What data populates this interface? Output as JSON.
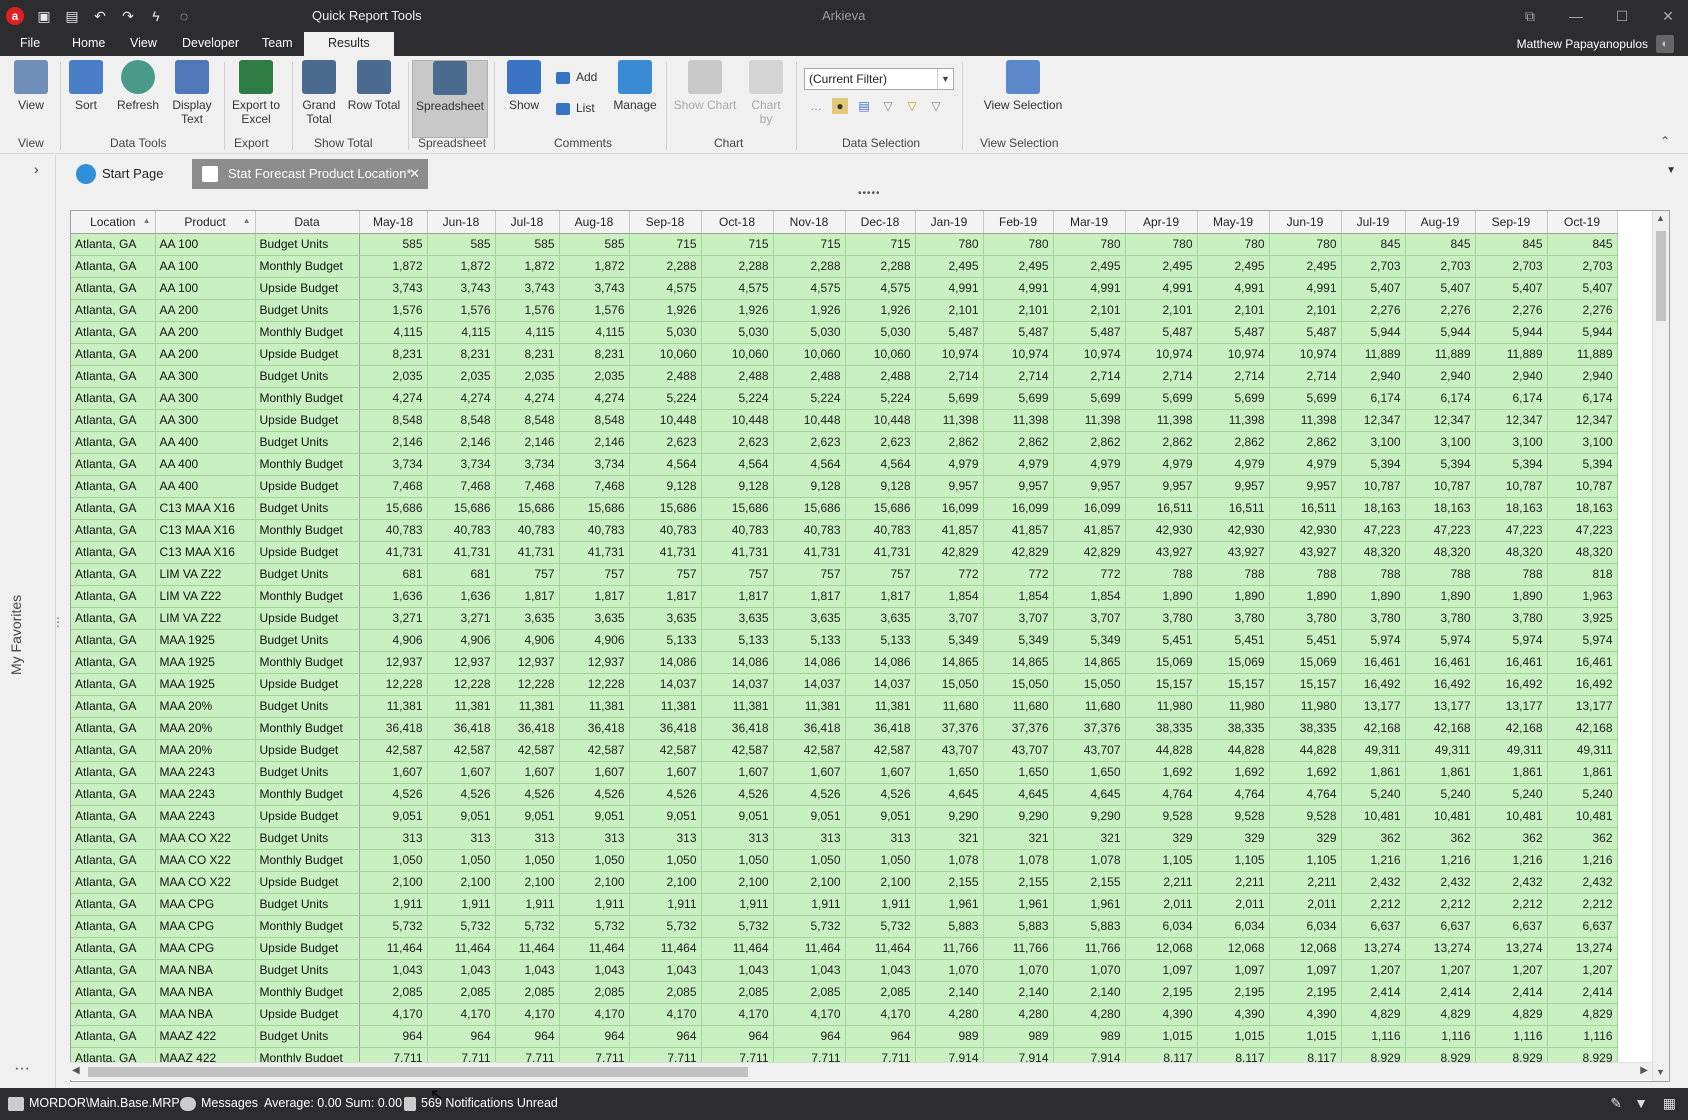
{
  "titlebar": {
    "logo": "a",
    "tool_title": "Quick Report Tools",
    "app_title": "Arkieva"
  },
  "menu": {
    "tabs": [
      "File",
      "Home",
      "View",
      "Developer",
      "Team",
      "Results"
    ],
    "active": "Results",
    "user": "Matthew Papayanopulos"
  },
  "ribbon": {
    "view": "View",
    "sort": "Sort",
    "refresh": "Refresh",
    "display_text": "Display Text",
    "export_excel": "Export to Excel",
    "grand_total": "Grand Total",
    "row_total": "Row Total",
    "spreadsheet": "Spreadsheet",
    "show": "Show",
    "add": "Add",
    "list": "List",
    "manage": "Manage",
    "show_chart": "Show Chart",
    "chart_by": "Chart by",
    "filter_value": "(Current Filter)",
    "view_selection": "View Selection",
    "groups": {
      "view": "View",
      "data_tools": "Data Tools",
      "export": "Export",
      "show_total": "Show Total",
      "spreadsheet": "Spreadsheet",
      "comments": "Comments",
      "chart": "Chart",
      "data_selection": "Data Selection",
      "view_selection": "View Selection"
    }
  },
  "sidebar": {
    "favorites": "My Favorites"
  },
  "doctabs": {
    "start": "Start Page",
    "active": "Stat Forecast Product Location*"
  },
  "grid": {
    "headers": [
      "Location",
      "Product",
      "Data",
      "May-18",
      "Jun-18",
      "Jul-18",
      "Aug-18",
      "Sep-18",
      "Oct-18",
      "Nov-18",
      "Dec-18",
      "Jan-19",
      "Feb-19",
      "Mar-19",
      "Apr-19",
      "May-19",
      "Jun-19",
      "Jul-19",
      "Aug-19",
      "Sep-19",
      "Oct-19"
    ],
    "rows": [
      [
        "Atlanta, GA",
        "AA 100",
        "Budget Units",
        "585",
        "585",
        "585",
        "585",
        "715",
        "715",
        "715",
        "715",
        "780",
        "780",
        "780",
        "780",
        "780",
        "780",
        "845",
        "845",
        "845",
        "845"
      ],
      [
        "Atlanta, GA",
        "AA 100",
        "Monthly Budget",
        "1,872",
        "1,872",
        "1,872",
        "1,872",
        "2,288",
        "2,288",
        "2,288",
        "2,288",
        "2,495",
        "2,495",
        "2,495",
        "2,495",
        "2,495",
        "2,495",
        "2,703",
        "2,703",
        "2,703",
        "2,703"
      ],
      [
        "Atlanta, GA",
        "AA 100",
        "Upside Budget",
        "3,743",
        "3,743",
        "3,743",
        "3,743",
        "4,575",
        "4,575",
        "4,575",
        "4,575",
        "4,991",
        "4,991",
        "4,991",
        "4,991",
        "4,991",
        "4,991",
        "5,407",
        "5,407",
        "5,407",
        "5,407"
      ],
      [
        "Atlanta, GA",
        "AA 200",
        "Budget Units",
        "1,576",
        "1,576",
        "1,576",
        "1,576",
        "1,926",
        "1,926",
        "1,926",
        "1,926",
        "2,101",
        "2,101",
        "2,101",
        "2,101",
        "2,101",
        "2,101",
        "2,276",
        "2,276",
        "2,276",
        "2,276"
      ],
      [
        "Atlanta, GA",
        "AA 200",
        "Monthly Budget",
        "4,115",
        "4,115",
        "4,115",
        "4,115",
        "5,030",
        "5,030",
        "5,030",
        "5,030",
        "5,487",
        "5,487",
        "5,487",
        "5,487",
        "5,487",
        "5,487",
        "5,944",
        "5,944",
        "5,944",
        "5,944"
      ],
      [
        "Atlanta, GA",
        "AA 200",
        "Upside Budget",
        "8,231",
        "8,231",
        "8,231",
        "8,231",
        "10,060",
        "10,060",
        "10,060",
        "10,060",
        "10,974",
        "10,974",
        "10,974",
        "10,974",
        "10,974",
        "10,974",
        "11,889",
        "11,889",
        "11,889",
        "11,889"
      ],
      [
        "Atlanta, GA",
        "AA 300",
        "Budget Units",
        "2,035",
        "2,035",
        "2,035",
        "2,035",
        "2,488",
        "2,488",
        "2,488",
        "2,488",
        "2,714",
        "2,714",
        "2,714",
        "2,714",
        "2,714",
        "2,714",
        "2,940",
        "2,940",
        "2,940",
        "2,940"
      ],
      [
        "Atlanta, GA",
        "AA 300",
        "Monthly Budget",
        "4,274",
        "4,274",
        "4,274",
        "4,274",
        "5,224",
        "5,224",
        "5,224",
        "5,224",
        "5,699",
        "5,699",
        "5,699",
        "5,699",
        "5,699",
        "5,699",
        "6,174",
        "6,174",
        "6,174",
        "6,174"
      ],
      [
        "Atlanta, GA",
        "AA 300",
        "Upside Budget",
        "8,548",
        "8,548",
        "8,548",
        "8,548",
        "10,448",
        "10,448",
        "10,448",
        "10,448",
        "11,398",
        "11,398",
        "11,398",
        "11,398",
        "11,398",
        "11,398",
        "12,347",
        "12,347",
        "12,347",
        "12,347"
      ],
      [
        "Atlanta, GA",
        "AA 400",
        "Budget Units",
        "2,146",
        "2,146",
        "2,146",
        "2,146",
        "2,623",
        "2,623",
        "2,623",
        "2,623",
        "2,862",
        "2,862",
        "2,862",
        "2,862",
        "2,862",
        "2,862",
        "3,100",
        "3,100",
        "3,100",
        "3,100"
      ],
      [
        "Atlanta, GA",
        "AA 400",
        "Monthly Budget",
        "3,734",
        "3,734",
        "3,734",
        "3,734",
        "4,564",
        "4,564",
        "4,564",
        "4,564",
        "4,979",
        "4,979",
        "4,979",
        "4,979",
        "4,979",
        "4,979",
        "5,394",
        "5,394",
        "5,394",
        "5,394"
      ],
      [
        "Atlanta, GA",
        "AA 400",
        "Upside Budget",
        "7,468",
        "7,468",
        "7,468",
        "7,468",
        "9,128",
        "9,128",
        "9,128",
        "9,128",
        "9,957",
        "9,957",
        "9,957",
        "9,957",
        "9,957",
        "9,957",
        "10,787",
        "10,787",
        "10,787",
        "10,787"
      ],
      [
        "Atlanta, GA",
        "C13 MAA X16",
        "Budget Units",
        "15,686",
        "15,686",
        "15,686",
        "15,686",
        "15,686",
        "15,686",
        "15,686",
        "15,686",
        "16,099",
        "16,099",
        "16,099",
        "16,511",
        "16,511",
        "16,511",
        "18,163",
        "18,163",
        "18,163",
        "18,163"
      ],
      [
        "Atlanta, GA",
        "C13 MAA X16",
        "Monthly Budget",
        "40,783",
        "40,783",
        "40,783",
        "40,783",
        "40,783",
        "40,783",
        "40,783",
        "40,783",
        "41,857",
        "41,857",
        "41,857",
        "42,930",
        "42,930",
        "42,930",
        "47,223",
        "47,223",
        "47,223",
        "47,223"
      ],
      [
        "Atlanta, GA",
        "C13 MAA X16",
        "Upside Budget",
        "41,731",
        "41,731",
        "41,731",
        "41,731",
        "41,731",
        "41,731",
        "41,731",
        "41,731",
        "42,829",
        "42,829",
        "42,829",
        "43,927",
        "43,927",
        "43,927",
        "48,320",
        "48,320",
        "48,320",
        "48,320"
      ],
      [
        "Atlanta, GA",
        "LIM VA Z22",
        "Budget Units",
        "681",
        "681",
        "757",
        "757",
        "757",
        "757",
        "757",
        "757",
        "772",
        "772",
        "772",
        "788",
        "788",
        "788",
        "788",
        "788",
        "788",
        "818"
      ],
      [
        "Atlanta, GA",
        "LIM VA Z22",
        "Monthly Budget",
        "1,636",
        "1,636",
        "1,817",
        "1,817",
        "1,817",
        "1,817",
        "1,817",
        "1,817",
        "1,854",
        "1,854",
        "1,854",
        "1,890",
        "1,890",
        "1,890",
        "1,890",
        "1,890",
        "1,890",
        "1,963"
      ],
      [
        "Atlanta, GA",
        "LIM VA Z22",
        "Upside Budget",
        "3,271",
        "3,271",
        "3,635",
        "3,635",
        "3,635",
        "3,635",
        "3,635",
        "3,635",
        "3,707",
        "3,707",
        "3,707",
        "3,780",
        "3,780",
        "3,780",
        "3,780",
        "3,780",
        "3,780",
        "3,925"
      ],
      [
        "Atlanta, GA",
        "MAA 1925",
        "Budget Units",
        "4,906",
        "4,906",
        "4,906",
        "4,906",
        "5,133",
        "5,133",
        "5,133",
        "5,133",
        "5,349",
        "5,349",
        "5,349",
        "5,451",
        "5,451",
        "5,451",
        "5,974",
        "5,974",
        "5,974",
        "5,974"
      ],
      [
        "Atlanta, GA",
        "MAA 1925",
        "Monthly Budget",
        "12,937",
        "12,937",
        "12,937",
        "12,937",
        "14,086",
        "14,086",
        "14,086",
        "14,086",
        "14,865",
        "14,865",
        "14,865",
        "15,069",
        "15,069",
        "15,069",
        "16,461",
        "16,461",
        "16,461",
        "16,461"
      ],
      [
        "Atlanta, GA",
        "MAA 1925",
        "Upside Budget",
        "12,228",
        "12,228",
        "12,228",
        "12,228",
        "14,037",
        "14,037",
        "14,037",
        "14,037",
        "15,050",
        "15,050",
        "15,050",
        "15,157",
        "15,157",
        "15,157",
        "16,492",
        "16,492",
        "16,492",
        "16,492"
      ],
      [
        "Atlanta, GA",
        "MAA 20%",
        "Budget Units",
        "11,381",
        "11,381",
        "11,381",
        "11,381",
        "11,381",
        "11,381",
        "11,381",
        "11,381",
        "11,680",
        "11,680",
        "11,680",
        "11,980",
        "11,980",
        "11,980",
        "13,177",
        "13,177",
        "13,177",
        "13,177"
      ],
      [
        "Atlanta, GA",
        "MAA 20%",
        "Monthly Budget",
        "36,418",
        "36,418",
        "36,418",
        "36,418",
        "36,418",
        "36,418",
        "36,418",
        "36,418",
        "37,376",
        "37,376",
        "37,376",
        "38,335",
        "38,335",
        "38,335",
        "42,168",
        "42,168",
        "42,168",
        "42,168"
      ],
      [
        "Atlanta, GA",
        "MAA 20%",
        "Upside Budget",
        "42,587",
        "42,587",
        "42,587",
        "42,587",
        "42,587",
        "42,587",
        "42,587",
        "42,587",
        "43,707",
        "43,707",
        "43,707",
        "44,828",
        "44,828",
        "44,828",
        "49,311",
        "49,311",
        "49,311",
        "49,311"
      ],
      [
        "Atlanta, GA",
        "MAA 2243",
        "Budget Units",
        "1,607",
        "1,607",
        "1,607",
        "1,607",
        "1,607",
        "1,607",
        "1,607",
        "1,607",
        "1,650",
        "1,650",
        "1,650",
        "1,692",
        "1,692",
        "1,692",
        "1,861",
        "1,861",
        "1,861",
        "1,861"
      ],
      [
        "Atlanta, GA",
        "MAA 2243",
        "Monthly Budget",
        "4,526",
        "4,526",
        "4,526",
        "4,526",
        "4,526",
        "4,526",
        "4,526",
        "4,526",
        "4,645",
        "4,645",
        "4,645",
        "4,764",
        "4,764",
        "4,764",
        "5,240",
        "5,240",
        "5,240",
        "5,240"
      ],
      [
        "Atlanta, GA",
        "MAA 2243",
        "Upside Budget",
        "9,051",
        "9,051",
        "9,051",
        "9,051",
        "9,051",
        "9,051",
        "9,051",
        "9,051",
        "9,290",
        "9,290",
        "9,290",
        "9,528",
        "9,528",
        "9,528",
        "10,481",
        "10,481",
        "10,481",
        "10,481"
      ],
      [
        "Atlanta, GA",
        "MAA CO X22",
        "Budget Units",
        "313",
        "313",
        "313",
        "313",
        "313",
        "313",
        "313",
        "313",
        "321",
        "321",
        "321",
        "329",
        "329",
        "329",
        "362",
        "362",
        "362",
        "362"
      ],
      [
        "Atlanta, GA",
        "MAA CO X22",
        "Monthly Budget",
        "1,050",
        "1,050",
        "1,050",
        "1,050",
        "1,050",
        "1,050",
        "1,050",
        "1,050",
        "1,078",
        "1,078",
        "1,078",
        "1,105",
        "1,105",
        "1,105",
        "1,216",
        "1,216",
        "1,216",
        "1,216"
      ],
      [
        "Atlanta, GA",
        "MAA CO X22",
        "Upside Budget",
        "2,100",
        "2,100",
        "2,100",
        "2,100",
        "2,100",
        "2,100",
        "2,100",
        "2,100",
        "2,155",
        "2,155",
        "2,155",
        "2,211",
        "2,211",
        "2,211",
        "2,432",
        "2,432",
        "2,432",
        "2,432"
      ],
      [
        "Atlanta, GA",
        "MAA CPG",
        "Budget Units",
        "1,911",
        "1,911",
        "1,911",
        "1,911",
        "1,911",
        "1,911",
        "1,911",
        "1,911",
        "1,961",
        "1,961",
        "1,961",
        "2,011",
        "2,011",
        "2,011",
        "2,212",
        "2,212",
        "2,212",
        "2,212"
      ],
      [
        "Atlanta, GA",
        "MAA CPG",
        "Monthly Budget",
        "5,732",
        "5,732",
        "5,732",
        "5,732",
        "5,732",
        "5,732",
        "5,732",
        "5,732",
        "5,883",
        "5,883",
        "5,883",
        "6,034",
        "6,034",
        "6,034",
        "6,637",
        "6,637",
        "6,637",
        "6,637"
      ],
      [
        "Atlanta, GA",
        "MAA CPG",
        "Upside Budget",
        "11,464",
        "11,464",
        "11,464",
        "11,464",
        "11,464",
        "11,464",
        "11,464",
        "11,464",
        "11,766",
        "11,766",
        "11,766",
        "12,068",
        "12,068",
        "12,068",
        "13,274",
        "13,274",
        "13,274",
        "13,274"
      ],
      [
        "Atlanta, GA",
        "MAA NBA",
        "Budget Units",
        "1,043",
        "1,043",
        "1,043",
        "1,043",
        "1,043",
        "1,043",
        "1,043",
        "1,043",
        "1,070",
        "1,070",
        "1,070",
        "1,097",
        "1,097",
        "1,097",
        "1,207",
        "1,207",
        "1,207",
        "1,207"
      ],
      [
        "Atlanta, GA",
        "MAA NBA",
        "Monthly Budget",
        "2,085",
        "2,085",
        "2,085",
        "2,085",
        "2,085",
        "2,085",
        "2,085",
        "2,085",
        "2,140",
        "2,140",
        "2,140",
        "2,195",
        "2,195",
        "2,195",
        "2,414",
        "2,414",
        "2,414",
        "2,414"
      ],
      [
        "Atlanta, GA",
        "MAA NBA",
        "Upside Budget",
        "4,170",
        "4,170",
        "4,170",
        "4,170",
        "4,170",
        "4,170",
        "4,170",
        "4,170",
        "4,280",
        "4,280",
        "4,280",
        "4,390",
        "4,390",
        "4,390",
        "4,829",
        "4,829",
        "4,829",
        "4,829"
      ],
      [
        "Atlanta, GA",
        "MAAZ 422",
        "Budget Units",
        "964",
        "964",
        "964",
        "964",
        "964",
        "964",
        "964",
        "964",
        "989",
        "989",
        "989",
        "1,015",
        "1,015",
        "1,015",
        "1,116",
        "1,116",
        "1,116",
        "1,116"
      ],
      [
        "Atlanta, GA",
        "MAAZ 422",
        "Monthly Budget",
        "7,711",
        "7,711",
        "7,711",
        "7,711",
        "7,711",
        "7,711",
        "7,711",
        "7,711",
        "7,914",
        "7,914",
        "7,914",
        "8,117",
        "8,117",
        "8,117",
        "8,929",
        "8,929",
        "8,929",
        "8,929"
      ]
    ]
  },
  "status": {
    "db": "MORDOR\\Main.Base.MRP",
    "messages": "Messages",
    "summary": "Average: 0.00 Sum: 0.00",
    "notifications": "569 Notifications Unread"
  }
}
